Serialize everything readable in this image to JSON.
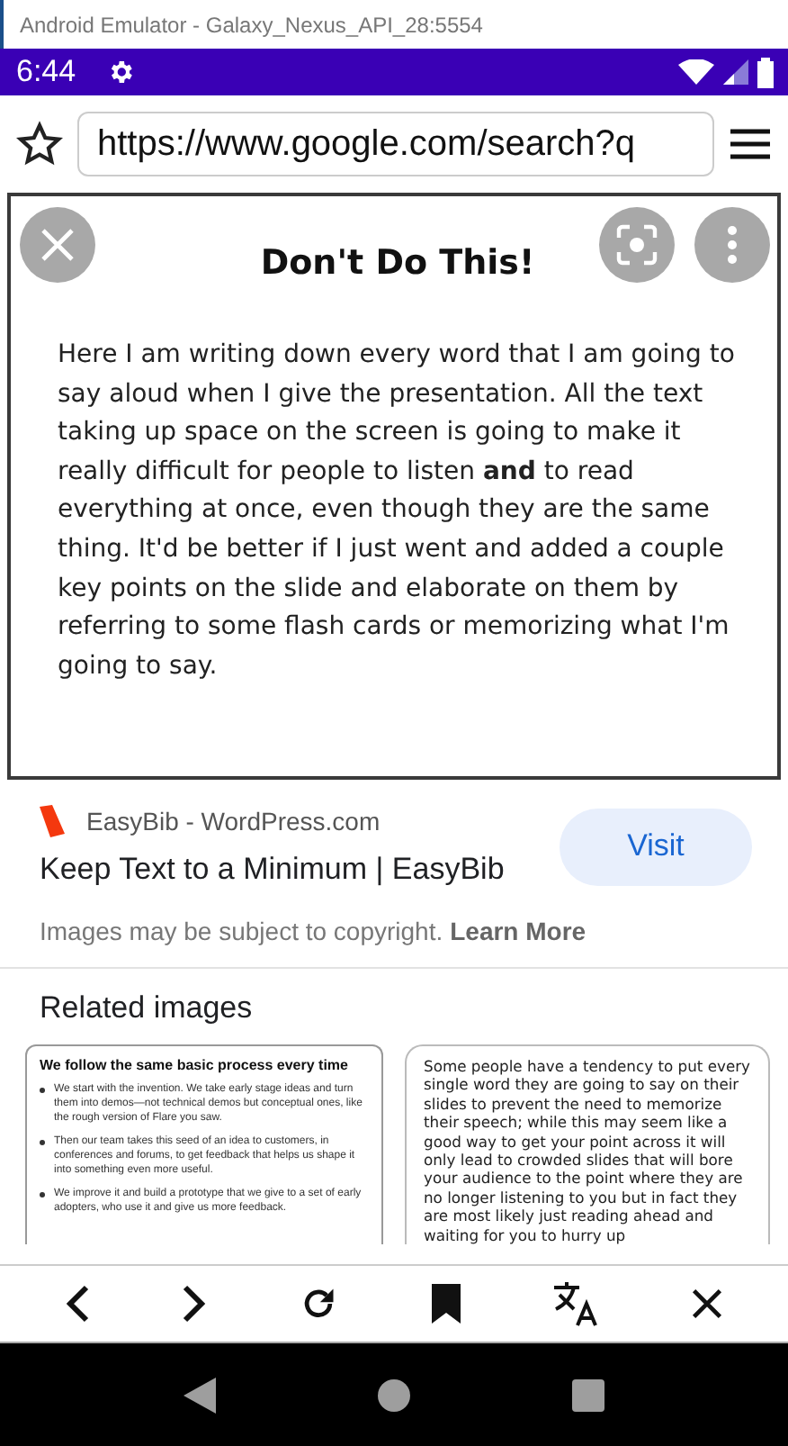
{
  "window": {
    "title": "Android Emulator - Galaxy_Nexus_API_28:5554"
  },
  "status_bar": {
    "time": "6:44"
  },
  "browser": {
    "url": "https://www.google.com/search?q"
  },
  "slide": {
    "title": "Don't Do This!",
    "body": "Here I am writing down every word that I am going to say aloud when I give the presentation. All the text taking up space on the screen is going to make it really difficult for people to listen **and** to read everything at once, even though they are the same thing. It'd be better if I just went and added a couple key points on the slide and elaborate on them by referring to some flash cards or memorizing what I'm going to say."
  },
  "result": {
    "source": "EasyBib - WordPress.com",
    "title": "Keep Text to a Minimum | EasyBib",
    "visit": "Visit",
    "notice": "Images may be subject to copyright.",
    "notice_link": "Learn More"
  },
  "related": {
    "heading": "Related images",
    "thumbnails": [
      {
        "kind": "bulleted",
        "title": "We follow the same basic process every time",
        "bullets": [
          "We start with the invention. We take early stage ideas and turn them into demos—not technical demos but conceptual ones, like the rough version of Flare you saw.",
          "Then our team takes this seed of an idea to customers, in conferences and forums, to get feedback that helps us shape it into something even more useful.",
          "We improve it and build a prototype that we give to a set of early adopters, who use it and give us more feedback."
        ]
      },
      {
        "kind": "paragraph",
        "text": "Some people have a tendency to put every single word they are going to say on their slides to prevent the need to memorize their speech; while this may seem like a good way to get your point across it will only lead to crowded slides that will bore your audience to the point where they are no longer listening to you but in fact they are most likely just reading ahead and waiting for you to hurry up"
      }
    ]
  }
}
